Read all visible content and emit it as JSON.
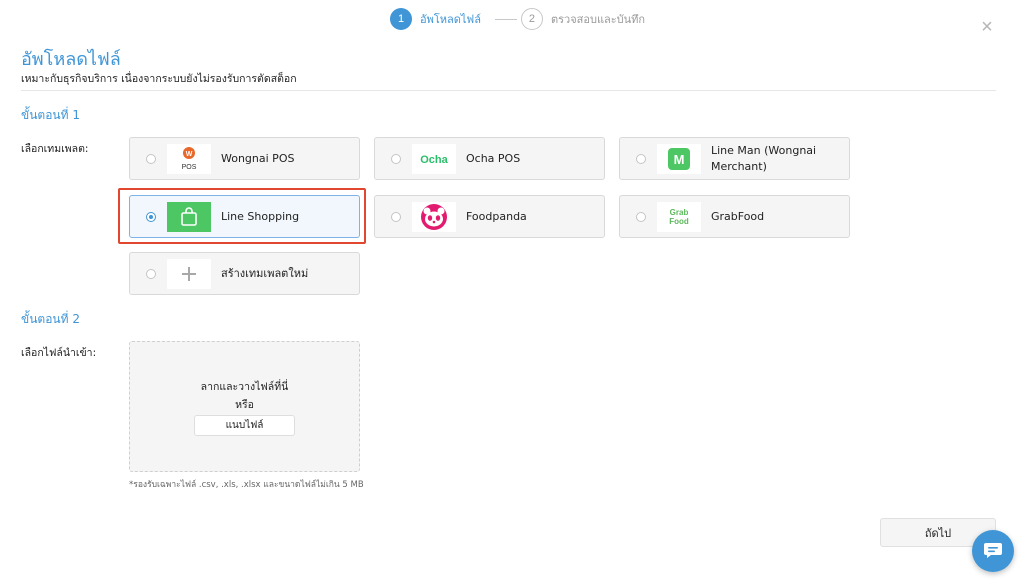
{
  "stepper": {
    "steps": [
      {
        "number": "1",
        "label": "อัพโหลดไฟล์",
        "state": "active"
      },
      {
        "number": "2",
        "label": "ตรวจสอบและบันทึก",
        "state": "inactive"
      }
    ]
  },
  "close": {
    "icon": "close-icon",
    "glyph": "×"
  },
  "header": {
    "title": "อัพโหลดไฟล์",
    "subtitle": "เหมาะกับธุรกิจบริการ เนื่องจากระบบยังไม่รองรับการตัดสต็อก"
  },
  "step1": {
    "heading": "ขั้นตอนที่ 1",
    "field_label": "เลือกเทมเพลต:",
    "templates": [
      {
        "name": "Wongnai POS",
        "logo": "wongnai-pos-logo",
        "logo_text": "POS",
        "selected": false
      },
      {
        "name": "Ocha POS",
        "logo": "ocha-logo",
        "logo_text": "Ocha",
        "selected": false
      },
      {
        "name": "Line Man (Wongnai Merchant)",
        "logo": "line-man-logo",
        "logo_text": "M",
        "selected": false
      },
      {
        "name": "Line Shopping",
        "logo": "line-shopping-logo",
        "selected": true
      },
      {
        "name": "Foodpanda",
        "logo": "foodpanda-logo",
        "selected": false
      },
      {
        "name": "GrabFood",
        "logo": "grabfood-logo",
        "logo_text": "Grab Food",
        "selected": false
      },
      {
        "name": "สร้างเทมเพลตใหม่",
        "logo": "plus-icon",
        "selected": false
      }
    ]
  },
  "step2": {
    "heading": "ขั้นตอนที่ 2",
    "field_label": "เลือกไฟล์นำเข้า:",
    "dropzone_text": "ลากและวางไฟล์ที่นี่",
    "or_text": "หรือ",
    "attach_label": "แนบไฟล์",
    "note": "*รองรับเฉพาะไฟล์ .csv, .xls, .xlsx และขนาดไฟล์ไม่เกิน 5 MB"
  },
  "footer": {
    "next_label": "ถัดไป"
  },
  "chat": {
    "icon": "chat-bubble-icon"
  },
  "colors": {
    "accent": "#3f95d6",
    "highlight": "#e0472e",
    "wongnai_orange": "#e8672a",
    "ocha_green": "#2bbf6a",
    "line_green": "#4cc764",
    "foodpanda_pink": "#e21b70",
    "grab_green": "#5bb85b"
  }
}
